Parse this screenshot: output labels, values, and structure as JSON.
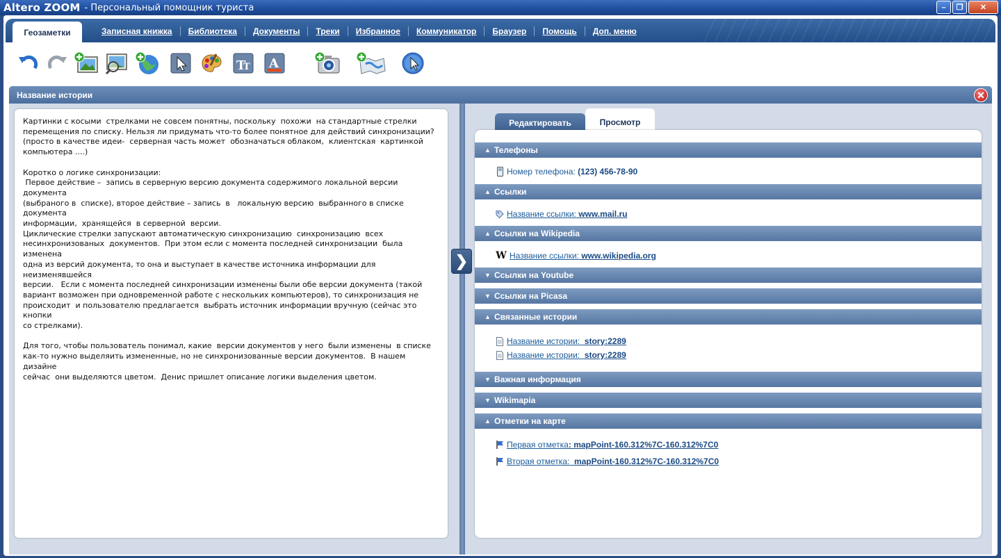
{
  "titlebar": {
    "logo": "Altero ZOOM",
    "subtitle": "- Персональный помощник туриста",
    "minimize": "–",
    "maximize": "❐",
    "close": "✕"
  },
  "nav": {
    "active": "Геозаметки",
    "items": [
      "Записная книжка",
      "Библиотека",
      "Документы",
      "Треки",
      "Избранное",
      "Коммуникатор",
      "Браузер",
      "Помощь",
      "Доп. меню"
    ]
  },
  "story": {
    "title": "Название истории",
    "close_glyph": "✕",
    "split_arrow": "❯",
    "text_paragraphs": [
      "Картинки с косыми  стрелками не совсем понятны, поскольку  похожи  на стандартные стрелки\nперемещения по списку. Нельзя ли придумать что-то более понятное для действий синхронизации?\n(просто в качестве идеи-  серверная часть может  обозначаться облаком,  клиентская  картинкой\nкомпьютера ....)",
      "Коротко о логике синхронизации:\n Первое действие –  запись в серверную версию документа содержимого локальной версии документа\n(выбраного в  списке), второе действие – запись  в   локальную версию  выбранного в списке документа\nинформации,  хранящейся  в серверной  версии.\nЦиклические стрелки запускают автоматическую синхронизацию  синхронизацию  всех\nнесинхронизованых  документов.  При этом если с момента последней синхронизации  была изменена\nодна из версий документа, то она и выступает в качестве источника информации для неизменявшейся\nверсии.   Если с момента последней синхронизации изменены были обе версии документа (такой\nвариант возможен при одновременной работе с нескольких компьютеров), то синхронизация не\nпроисходит  и пользователю предлагается  выбрать источник информации вручную (сейчас это кнопки\nсо стрелками).",
      "Для того, чтобы пользователь понимал, какие  версии документов у него  были изменены  в списке\nкак-то нужно выделяить измененные, но не синхронизованные версии документов.  В нашем дизайне\nсейчас  они выделяются цветом.  Денис пришлет описание логики выделения цветом."
    ]
  },
  "tabs": {
    "edit": "Редактировать",
    "view": "Просмотр"
  },
  "sections": {
    "phones": {
      "title": "Телефоны",
      "label": "Номер телефона:",
      "value": "(123) 456-78-90"
    },
    "links": {
      "title": "Ссылки",
      "label": "Название ссылки:",
      "value": "www.mail.ru"
    },
    "wiki": {
      "title": "Ссылки на Wikipedia",
      "label": "Название ссылки:",
      "value": "www.wikipedia.org",
      "icon_letter": "W"
    },
    "youtube": {
      "title": "Ссылки на Youtube"
    },
    "picasa": {
      "title": "Ссылки на Picasa"
    },
    "related": {
      "title": "Связанные истории",
      "items": [
        {
          "label": "Название истории:",
          "value": "story:2289"
        },
        {
          "label": "Название истории:",
          "value": "story:2289"
        }
      ]
    },
    "important": {
      "title": "Важная информация"
    },
    "wikimapia": {
      "title": "Wikimapia"
    },
    "marks": {
      "title": "Отметки на карте",
      "items": [
        {
          "label": "Первая отметка",
          "value": "mapPoint-160.312%7C-160.312%7C0"
        },
        {
          "label": "Вторая отметка:",
          "value": "mapPoint-160.312%7C-160.312%7C0"
        }
      ]
    }
  },
  "glyphs": {
    "expanded": "▲",
    "collapsed": "▼"
  },
  "toolbar_icons": [
    "undo-icon",
    "redo-icon",
    "add-image-icon",
    "image-search-icon",
    "add-globe-icon",
    "cursor-icon",
    "palette-icon",
    "text-size-icon",
    "text-color-icon",
    "add-camera-icon",
    "add-map-icon",
    "globe-cursor-icon"
  ]
}
